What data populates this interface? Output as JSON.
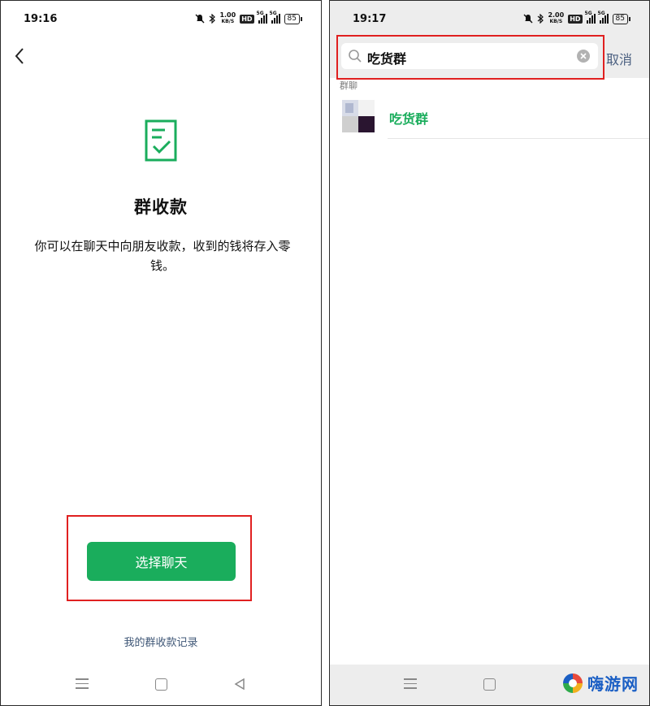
{
  "left_screen": {
    "status_bar": {
      "time": "19:16",
      "net_speed_value": "1.00",
      "net_speed_unit": "KB/S",
      "hd_badge": "HD",
      "signal1_label": "5G",
      "signal2_label": "5G",
      "battery": "85"
    },
    "title": "群收款",
    "description": "你可以在聊天中向朋友收款，收到的钱将存入零钱。",
    "primary_button": "选择聊天",
    "record_link": "我的群收款记录"
  },
  "right_screen": {
    "status_bar": {
      "time": "19:17",
      "net_speed_value": "2.00",
      "net_speed_unit": "KB/S",
      "hd_badge": "HD",
      "signal1_label": "5G",
      "signal2_label": "5G",
      "battery": "85"
    },
    "search": {
      "value": "吃货群"
    },
    "cancel": "取消",
    "section_label": "群聊",
    "results": [
      {
        "name": "吃货群"
      }
    ]
  },
  "watermark": {
    "text": "嗨游网"
  },
  "colors": {
    "accent": "#1aad5c",
    "highlight": "#e02020",
    "link": "#3f5777"
  },
  "icons": [
    "back-icon",
    "document-check-icon",
    "search-icon",
    "clear-icon",
    "menu-icon",
    "home-icon",
    "nav-back-icon"
  ]
}
